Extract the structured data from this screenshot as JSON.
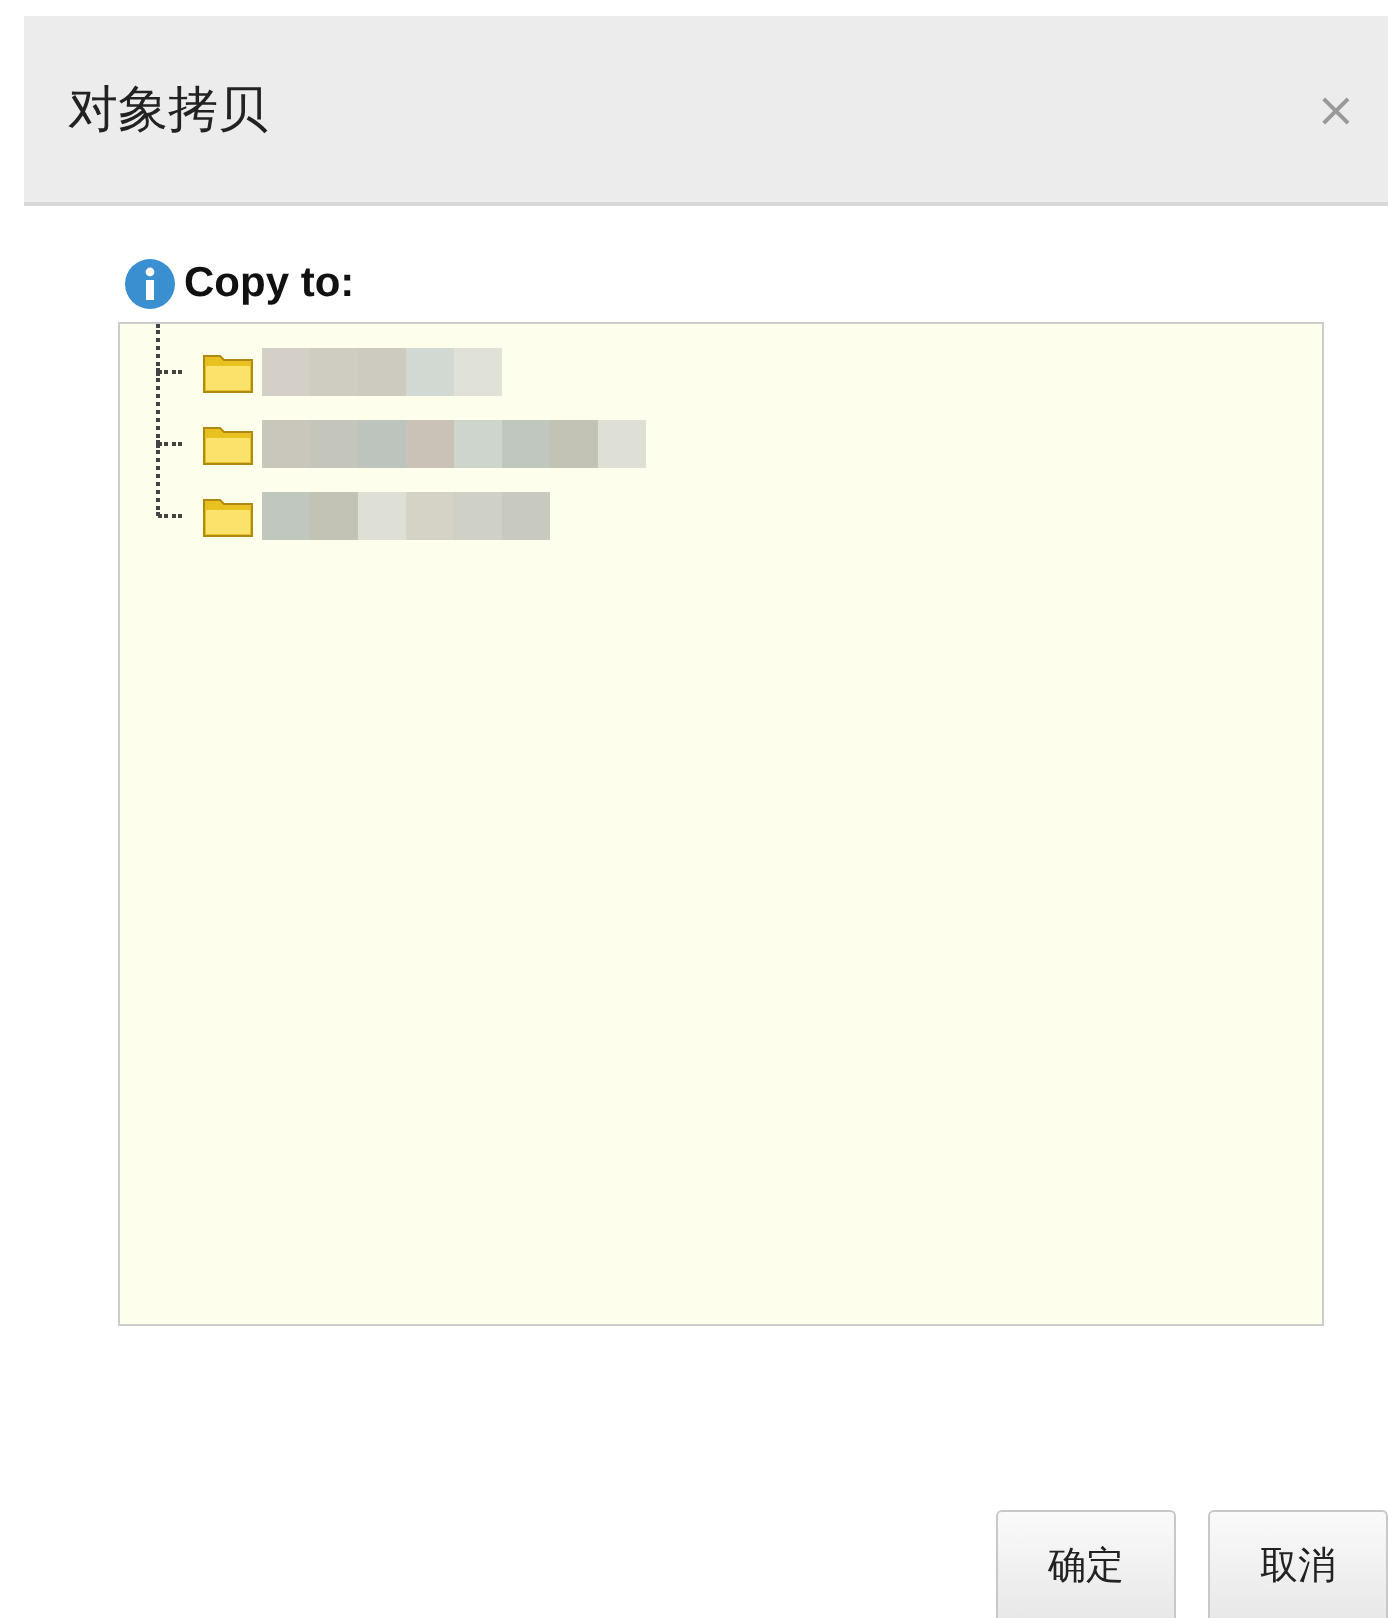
{
  "dialog": {
    "title": "对象拷贝",
    "close": "×"
  },
  "prompt": {
    "label": "Copy to:"
  },
  "tree": {
    "items": [
      {
        "kind": "folder"
      },
      {
        "kind": "folder"
      },
      {
        "kind": "folder"
      }
    ]
  },
  "buttons": [
    "确定",
    "取消"
  ]
}
